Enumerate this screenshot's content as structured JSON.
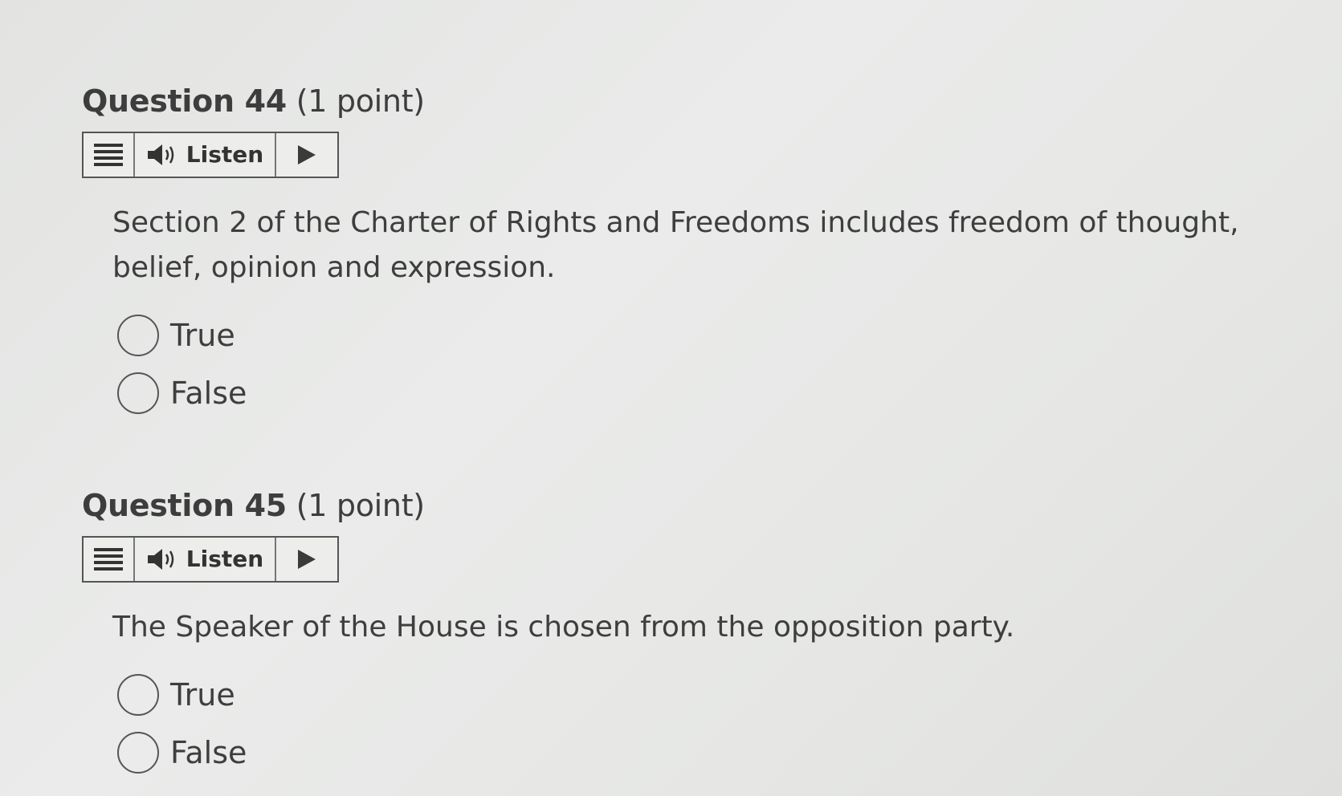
{
  "questions": [
    {
      "number": "Question 44",
      "points": "(1 point)",
      "listen_label": "Listen",
      "text": "Section 2 of the Charter of Rights and Freedoms includes freedom of thought, belief, opinion and expression.",
      "options": [
        "True",
        "False"
      ]
    },
    {
      "number": "Question 45",
      "points": "(1 point)",
      "listen_label": "Listen",
      "text": "The Speaker of the House is chosen from the opposition party.",
      "options": [
        "True",
        "False"
      ]
    }
  ],
  "icons": {
    "menu": "menu-icon",
    "speaker": "speaker-icon",
    "play": "play-icon"
  },
  "colors": {
    "background": "#e6e7e5",
    "text": "#3d3d3d",
    "border": "#555555"
  }
}
